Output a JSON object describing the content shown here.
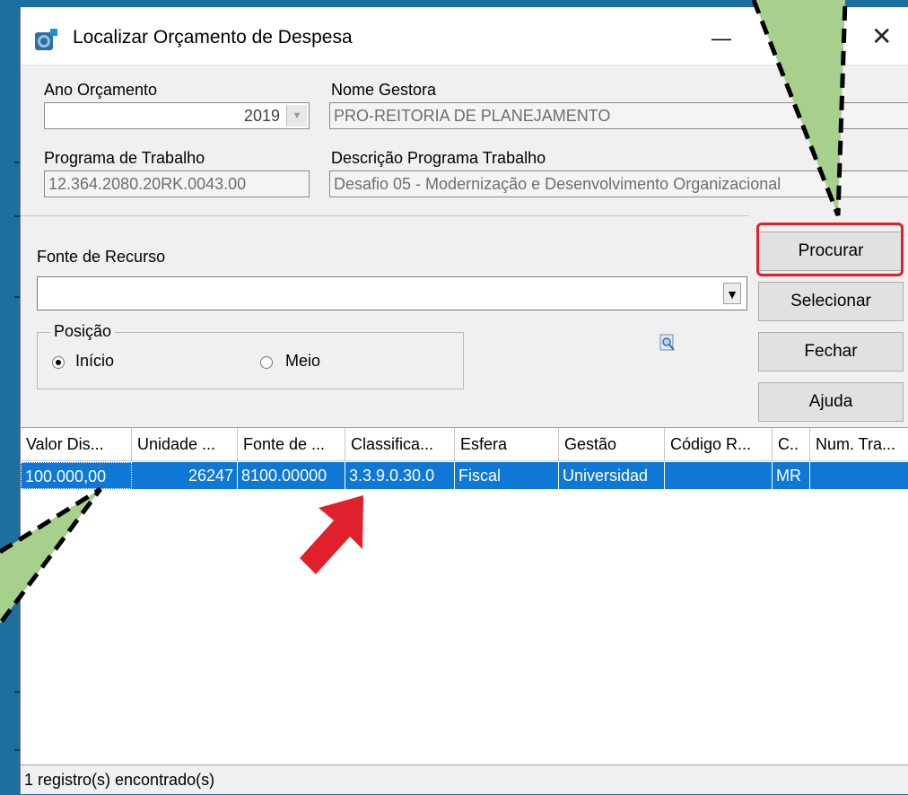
{
  "window": {
    "title": "Localizar Orçamento de Despesa",
    "minimize_glyph": "—",
    "close_glyph": "✕"
  },
  "form": {
    "ano_label": "Ano Orçamento",
    "ano_value": "2019",
    "gestora_label": "Nome Gestora",
    "gestora_value": "PRO-REITORIA DE PLANEJAMENTO",
    "programa_label": "Programa de Trabalho",
    "programa_value": "12.364.2080.20RK.0043.00",
    "descricao_label": "Descrição Programa Trabalho",
    "descricao_value": "Desafio 05 - Modernização e Desenvolvimento Organizacional",
    "fonte_label": "Fonte de Recurso",
    "fonte_value": "",
    "posicao_label": "Posição",
    "radio_inicio": "Início",
    "radio_meio": "Meio",
    "selected_position": "Início"
  },
  "buttons": {
    "procurar": "Procurar",
    "selecionar": "Selecionar",
    "fechar": "Fechar",
    "ajuda": "Ajuda"
  },
  "grid": {
    "columns": [
      "Valor Dis...",
      "Unidade ...",
      "Fonte de ...",
      "Classifica...",
      "Esfera",
      "Gestão",
      "Código R...",
      "C..",
      "Num. Tra..."
    ],
    "rows": [
      [
        "100.000,00",
        "26247",
        "8100.00000",
        "3.3.9.0.30.0",
        "Fiscal",
        "Universidad",
        "",
        "MR",
        ""
      ]
    ]
  },
  "status": {
    "text": "1 registro(s) encontrado(s)"
  },
  "colors": {
    "background_blue": "#1d6fa0",
    "selected_row": "#0f78d7",
    "highlight_red": "#e0202a",
    "callout_green": "#a6d08c"
  },
  "icons": {
    "app": "app-icon",
    "find": "magnifier-icon",
    "dropdown": "chevron-down-icon"
  }
}
